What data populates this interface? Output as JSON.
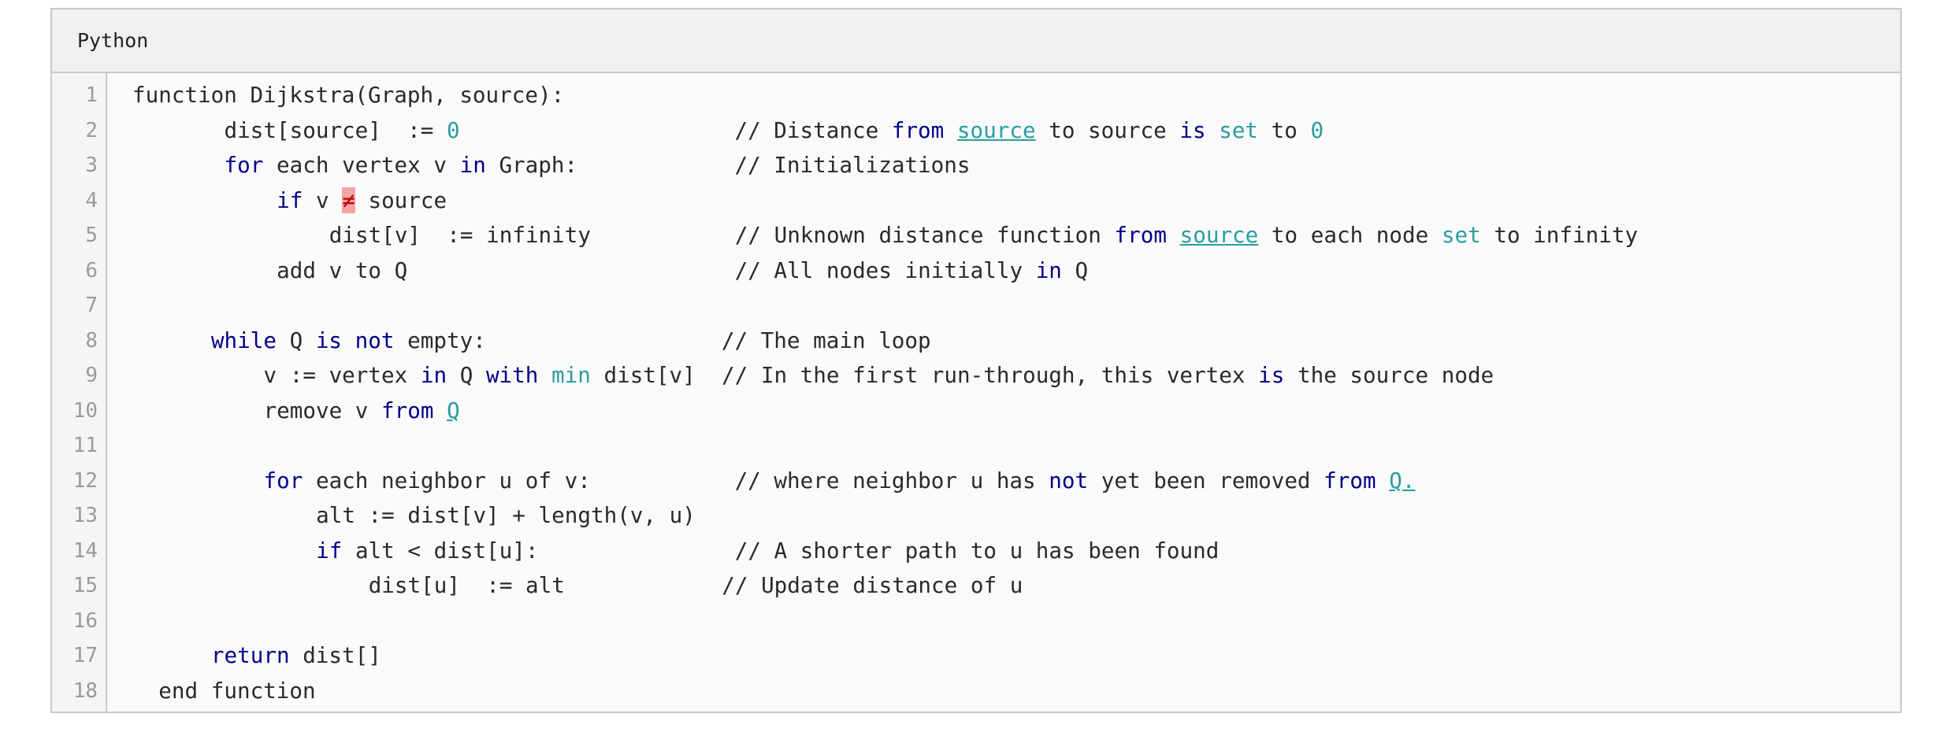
{
  "header": {
    "language": "Python"
  },
  "lines": [
    {
      "n": "1",
      "indent": 0,
      "tokens": [
        {
          "t": "function Dijkstra(Graph, source):"
        }
      ]
    },
    {
      "n": "2",
      "indent": 7,
      "tokens": [
        {
          "t": "dist[source]  := "
        },
        {
          "t": "0",
          "c": "bi"
        },
        {
          "t": "                     // Distance "
        },
        {
          "t": "from",
          "c": "kw"
        },
        {
          "t": " "
        },
        {
          "t": "source",
          "c": "ul"
        },
        {
          "t": " to source "
        },
        {
          "t": "is",
          "c": "kw"
        },
        {
          "t": " "
        },
        {
          "t": "set",
          "c": "bi"
        },
        {
          "t": " to "
        },
        {
          "t": "0",
          "c": "bi"
        }
      ]
    },
    {
      "n": "3",
      "indent": 7,
      "tokens": [
        {
          "t": "for",
          "c": "kw"
        },
        {
          "t": " each vertex v "
        },
        {
          "t": "in",
          "c": "kw"
        },
        {
          "t": " Graph:            // Initializations"
        }
      ]
    },
    {
      "n": "4",
      "indent": 11,
      "tokens": [
        {
          "t": "if",
          "c": "kw"
        },
        {
          "t": " v "
        },
        {
          "t": "≠",
          "c": "err"
        },
        {
          "t": " source"
        }
      ]
    },
    {
      "n": "5",
      "indent": 15,
      "tokens": [
        {
          "t": "dist[v]  := infinity           // Unknown distance function "
        },
        {
          "t": "from",
          "c": "kw"
        },
        {
          "t": " "
        },
        {
          "t": "source",
          "c": "ul"
        },
        {
          "t": " to each node "
        },
        {
          "t": "set",
          "c": "bi"
        },
        {
          "t": " to infinity"
        }
      ]
    },
    {
      "n": "6",
      "indent": 11,
      "tokens": [
        {
          "t": "add v to Q                         // All nodes initially "
        },
        {
          "t": "in",
          "c": "kw"
        },
        {
          "t": " Q"
        }
      ]
    },
    {
      "n": "7",
      "indent": 0,
      "tokens": []
    },
    {
      "n": "8",
      "indent": 6,
      "tokens": [
        {
          "t": "while",
          "c": "kw"
        },
        {
          "t": " Q "
        },
        {
          "t": "is",
          "c": "kw"
        },
        {
          "t": " "
        },
        {
          "t": "not",
          "c": "kw"
        },
        {
          "t": " empty:                  // The main loop"
        }
      ]
    },
    {
      "n": "9",
      "indent": 10,
      "tokens": [
        {
          "t": "v := vertex "
        },
        {
          "t": "in",
          "c": "kw"
        },
        {
          "t": " Q "
        },
        {
          "t": "with",
          "c": "kw"
        },
        {
          "t": " "
        },
        {
          "t": "min",
          "c": "bi"
        },
        {
          "t": " dist[v]  // In the first run-through, this vertex "
        },
        {
          "t": "is",
          "c": "kw"
        },
        {
          "t": " the source node"
        }
      ]
    },
    {
      "n": "10",
      "indent": 10,
      "tokens": [
        {
          "t": "remove v "
        },
        {
          "t": "from",
          "c": "kw"
        },
        {
          "t": " "
        },
        {
          "t": "Q",
          "c": "ul"
        }
      ]
    },
    {
      "n": "11",
      "indent": 0,
      "tokens": []
    },
    {
      "n": "12",
      "indent": 10,
      "tokens": [
        {
          "t": "for",
          "c": "kw"
        },
        {
          "t": " each neighbor u of v:           // where neighbor u has "
        },
        {
          "t": "not",
          "c": "kw"
        },
        {
          "t": " yet been removed "
        },
        {
          "t": "from",
          "c": "kw"
        },
        {
          "t": " "
        },
        {
          "t": "Q.",
          "c": "ul"
        }
      ]
    },
    {
      "n": "13",
      "indent": 14,
      "tokens": [
        {
          "t": "alt := dist[v] + length(v, u)"
        }
      ]
    },
    {
      "n": "14",
      "indent": 14,
      "tokens": [
        {
          "t": "if",
          "c": "kw"
        },
        {
          "t": " alt < dist[u]:               // A shorter path to u has been found"
        }
      ]
    },
    {
      "n": "15",
      "indent": 18,
      "tokens": [
        {
          "t": "dist[u]  := alt            // Update distance of u"
        }
      ]
    },
    {
      "n": "16",
      "indent": 0,
      "tokens": []
    },
    {
      "n": "17",
      "indent": 6,
      "tokens": [
        {
          "t": "return",
          "c": "kw"
        },
        {
          "t": " dist[]"
        }
      ]
    },
    {
      "n": "18",
      "indent": 2,
      "tokens": [
        {
          "t": "end function"
        }
      ]
    }
  ]
}
